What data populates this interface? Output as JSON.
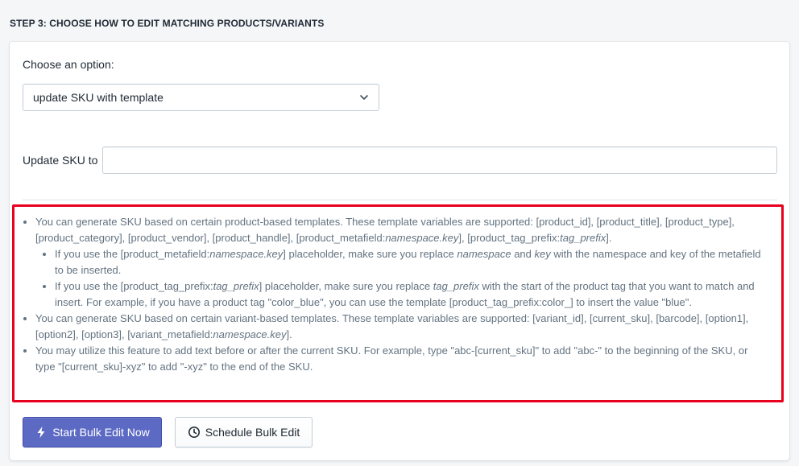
{
  "step_title": "STEP 3: CHOOSE HOW TO EDIT MATCHING PRODUCTS/VARIANTS",
  "option": {
    "label": "Choose an option:",
    "selected": "update SKU with template"
  },
  "sku": {
    "label": "Update SKU to",
    "value": ""
  },
  "info": {
    "bullet1": {
      "text_parts": [
        "You can generate SKU based on certain product-based templates. These template variables are supported: [product_id], [product_title], [product_type], [product_category], [product_vendor], [product_handle], [product_metafield:",
        "namespace.key",
        "], [product_tag_prefix:",
        "tag_prefix",
        "]."
      ],
      "sub1_parts": [
        "If you use the [product_metafield:",
        "namespace.key",
        "] placeholder, make sure you replace ",
        "namespace",
        " and ",
        "key",
        " with the namespace and key of the metafield to be inserted."
      ],
      "sub2_parts": [
        "If you use the [product_tag_prefix:",
        "tag_prefix",
        "] placeholder, make sure you replace ",
        "tag_prefix",
        " with the start of the product tag that you want to match and insert. For example, if you have a product tag \"color_blue\", you can use the template [product_tag_prefix:color_] to insert the value \"blue\"."
      ]
    },
    "bullet2_parts": [
      "You can generate SKU based on certain variant-based templates. These template variables are supported: [variant_id], [current_sku], [barcode], [option1], [option2], [option3], [variant_metafield:",
      "namespace.key",
      "]."
    ],
    "bullet3": "You may utilize this feature to add text before or after the current SKU. For example, type \"abc-[current_sku]\" to add \"abc-\" to the beginning of the SKU, or type \"[current_sku]-xyz\" to add \"-xyz\" to the end of the SKU."
  },
  "buttons": {
    "start": "Start Bulk Edit Now",
    "schedule": "Schedule Bulk Edit"
  },
  "icons": {
    "select": "chevron-down-icon",
    "start": "bolt-icon",
    "schedule": "clock-icon"
  },
  "colors": {
    "primary": "#5c6ac4",
    "highlight_border": "#e8001f",
    "help_text": "#637381"
  }
}
